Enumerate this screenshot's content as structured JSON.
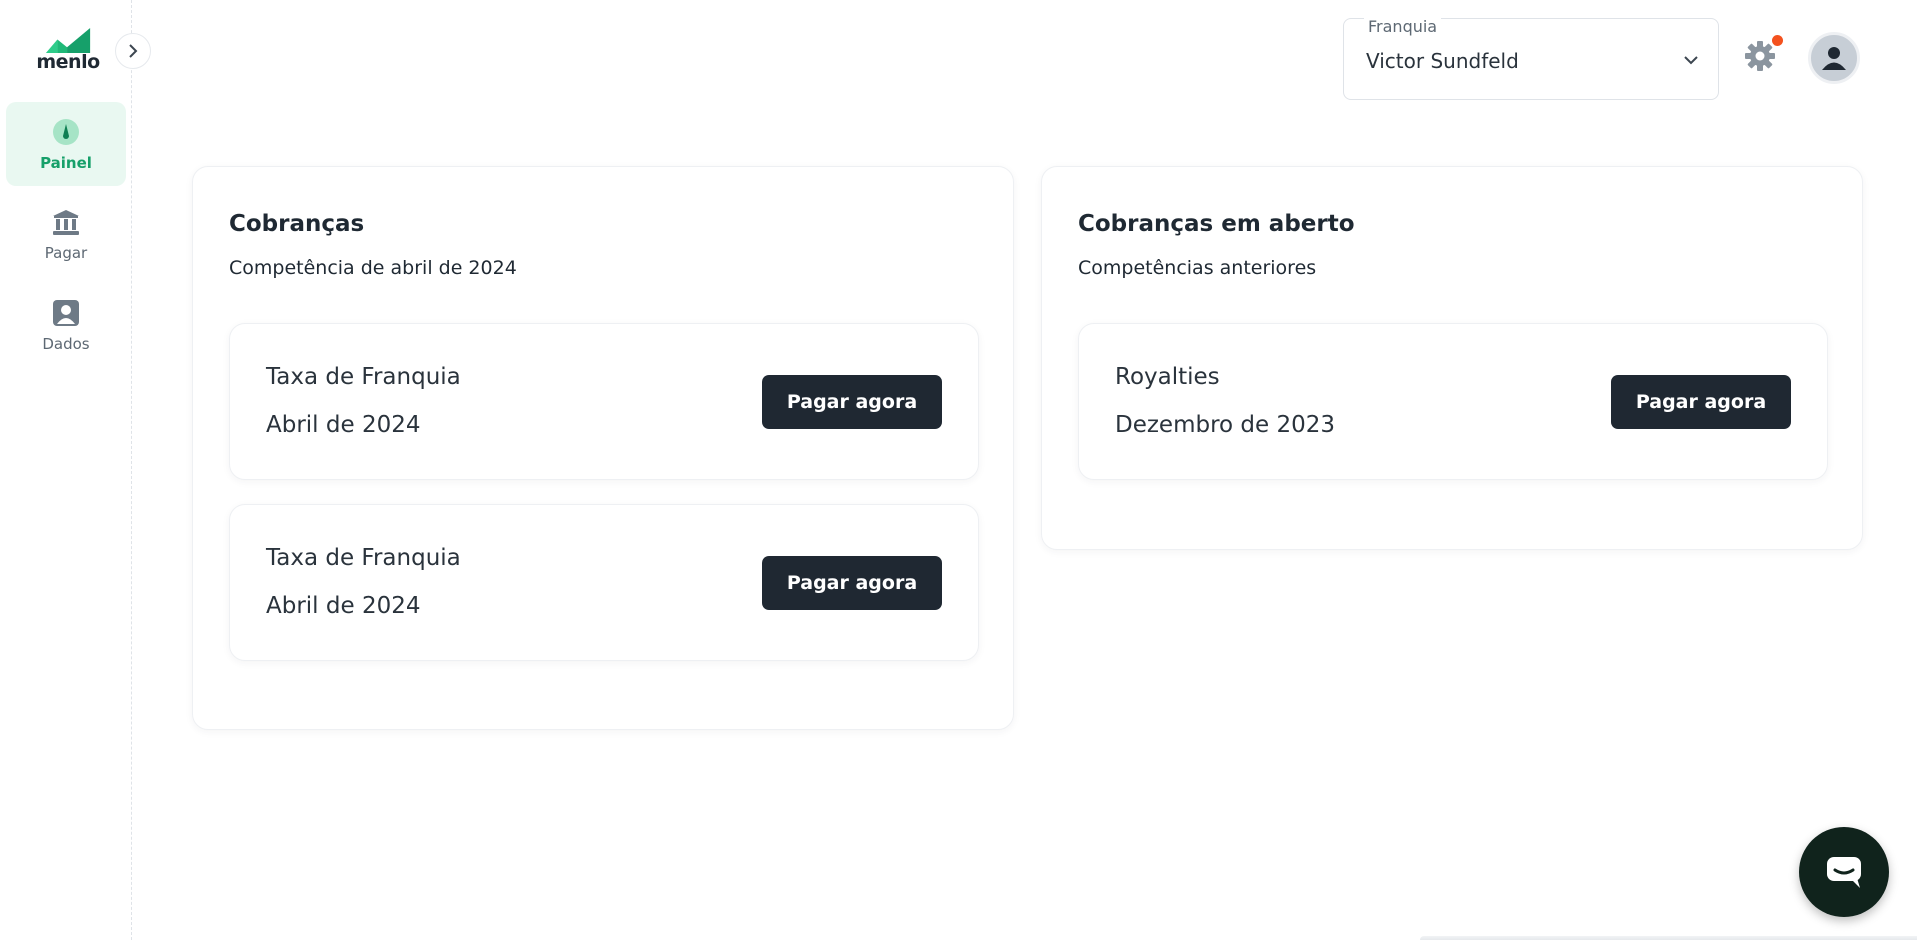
{
  "brand": {
    "name": "menlo",
    "accent": "#16a06a"
  },
  "sidebar": {
    "collapse_icon": "chevron-right-icon",
    "items": [
      {
        "label": "Painel",
        "icon": "dashboard-gauge-icon",
        "active": true
      },
      {
        "label": "Pagar",
        "icon": "bank-icon",
        "active": false
      },
      {
        "label": "Dados",
        "icon": "user-card-icon",
        "active": false
      }
    ]
  },
  "header": {
    "franchise_select": {
      "label": "Franquia",
      "value": "Victor Sundfeld"
    },
    "settings_icon": "gear-icon",
    "notification_color": "#f4511e",
    "avatar_icon": "user-avatar-icon"
  },
  "main": {
    "charges": {
      "title": "Cobranças",
      "subtitle": "Competência de abril de 2024",
      "items": [
        {
          "name": "Taxa de Franquia",
          "period": "Abril de 2024",
          "button": "Pagar agora"
        },
        {
          "name": "Taxa de Franquia",
          "period": "Abril de 2024",
          "button": "Pagar agora"
        }
      ]
    },
    "open_charges": {
      "title": "Cobranças em aberto",
      "subtitle": "Competências anteriores",
      "items": [
        {
          "name": "Royalties",
          "period": "Dezembro de 2023",
          "button": "Pagar agora"
        }
      ]
    }
  },
  "chat": {
    "icon": "chat-bubble-icon"
  }
}
